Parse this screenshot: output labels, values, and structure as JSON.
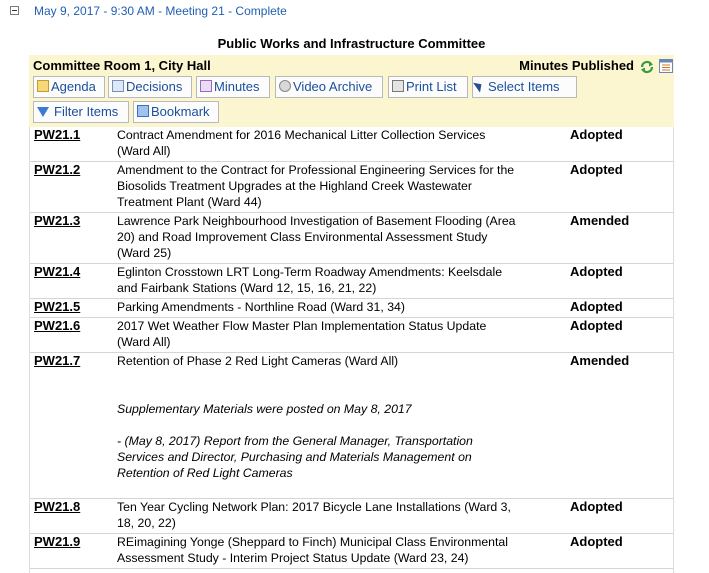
{
  "meeting": {
    "header_link": "May 9, 2017 - 9:30 AM - Meeting 21 - Complete",
    "committee": "Public Works and Infrastructure Committee",
    "location": "Committee Room 1, City Hall",
    "status": "Minutes Published"
  },
  "toolbar": {
    "agenda": "Agenda",
    "decisions": "Decisions",
    "minutes": "Minutes",
    "video_archive": "Video Archive",
    "print_list": "Print List",
    "select_items": "Select Items",
    "filter_items": "Filter Items",
    "bookmark": "Bookmark"
  },
  "items": [
    {
      "num": "PW21.1",
      "title_lines": [
        "Contract Amendment for 2016 Mechanical Litter Collection Services",
        "(Ward All)"
      ],
      "status": "Adopted"
    },
    {
      "num": "PW21.2",
      "title_lines": [
        "Amendment to the Contract for Professional Engineering Services for the",
        "Biosolids Treatment Upgrades at the Highland Creek Wastewater",
        "Treatment Plant  (Ward 44)"
      ],
      "status": "Adopted"
    },
    {
      "num": "PW21.3",
      "title_lines": [
        "Lawrence Park Neighbourhood Investigation of Basement Flooding (Area",
        "20) and Road Improvement Class Environmental Assessment Study",
        "(Ward 25)"
      ],
      "status": "Amended"
    },
    {
      "num": "PW21.4",
      "title_lines": [
        "Eglinton Crosstown LRT Long-Term Roadway Amendments: Keelsdale",
        "and Fairbank Stations  (Ward 12, 15, 16, 21, 22)"
      ],
      "status": "Adopted"
    },
    {
      "num": "PW21.5",
      "title_lines": [
        "Parking Amendments - Northline Road  (Ward 31, 34)"
      ],
      "status": "Adopted"
    },
    {
      "num": "PW21.6",
      "title_lines": [
        "2017 Wet Weather Flow Master Plan Implementation Status Update",
        "(Ward All)"
      ],
      "status": "Adopted"
    },
    {
      "num": "PW21.7",
      "title_lines": [
        "Retention of Phase 2 Red Light Cameras  (Ward All)"
      ],
      "status": "Amended",
      "supplementary": "Supplementary Materials were posted on May 8, 2017",
      "report_lines": [
        "- (May 8, 2017) Report from the General Manager, Transportation",
        "Services and Director, Purchasing and Materials Management on",
        "Retention of Red Light Cameras"
      ]
    },
    {
      "num": "PW21.8",
      "title_lines": [
        "Ten Year Cycling Network Plan: 2017 Bicycle Lane Installations  (Ward 3,",
        "18, 20, 22)"
      ],
      "status": "Adopted"
    },
    {
      "num": "PW21.9",
      "title_lines": [
        "REimagining Yonge (Sheppard to Finch) Municipal Class Environmental",
        "Assessment Study - Interim Project Status Update  (Ward 23, 24)"
      ],
      "status": "Adopted"
    }
  ]
}
